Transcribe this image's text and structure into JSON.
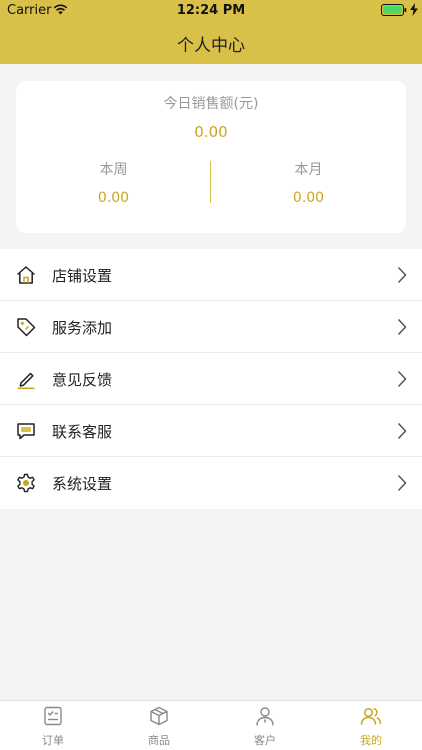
{
  "status_bar": {
    "carrier": "Carrier",
    "time": "12:24 PM"
  },
  "nav": {
    "title": "个人中心"
  },
  "sales": {
    "today_label": "今日销售额(元)",
    "today_value": "0.00",
    "week_label": "本周",
    "week_value": "0.00",
    "month_label": "本月",
    "month_value": "0.00"
  },
  "menu": {
    "items": [
      {
        "label": "店铺设置",
        "icon": "home-icon"
      },
      {
        "label": "服务添加",
        "icon": "tag-icon"
      },
      {
        "label": "意见反馈",
        "icon": "pencil-icon"
      },
      {
        "label": "联系客服",
        "icon": "chat-icon"
      },
      {
        "label": "系统设置",
        "icon": "gear-icon"
      }
    ]
  },
  "tabbar": {
    "tabs": [
      {
        "label": "订单",
        "icon": "clipboard-icon"
      },
      {
        "label": "商品",
        "icon": "box-icon"
      },
      {
        "label": "客户",
        "icon": "person-icon"
      },
      {
        "label": "我的",
        "icon": "users-icon"
      }
    ],
    "active_index": 3
  },
  "colors": {
    "accent": "#d9c049",
    "accent_text": "#c9a61e",
    "background": "#f4f4f4"
  }
}
